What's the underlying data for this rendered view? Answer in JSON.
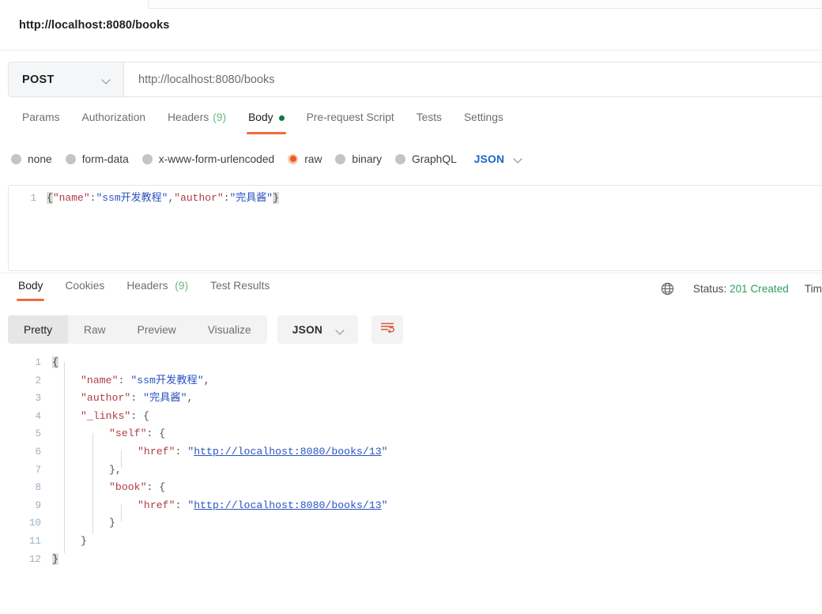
{
  "request": {
    "title": "http://localhost:8080/books",
    "method": "POST",
    "url": "http://localhost:8080/books",
    "tabs": [
      {
        "label": "Params",
        "active": false
      },
      {
        "label": "Authorization",
        "active": false
      },
      {
        "label": "Headers",
        "count": "(9)",
        "active": false
      },
      {
        "label": "Body",
        "active": true,
        "dot": true
      },
      {
        "label": "Pre-request Script",
        "active": false
      },
      {
        "label": "Tests",
        "active": false
      },
      {
        "label": "Settings",
        "active": false
      }
    ],
    "body_types": [
      {
        "label": "none",
        "selected": false
      },
      {
        "label": "form-data",
        "selected": false
      },
      {
        "label": "x-www-form-urlencoded",
        "selected": false
      },
      {
        "label": "raw",
        "selected": true
      },
      {
        "label": "binary",
        "selected": false
      },
      {
        "label": "GraphQL",
        "selected": false
      }
    ],
    "format": "JSON",
    "editor": {
      "line_number": "1",
      "raw": "{\"name\":\"ssm开发教程\",\"author\":\"完具酱\"}",
      "tokens": {
        "open_brace": "{",
        "key_name": "\"name\"",
        "colon1": ":",
        "val_name": "\"ssm开发教程\"",
        "comma": ",",
        "key_author": "\"author\"",
        "colon2": ":",
        "val_author": "\"完具酱\"",
        "close_brace": "}"
      }
    }
  },
  "response": {
    "tabs": [
      {
        "label": "Body",
        "active": true
      },
      {
        "label": "Cookies",
        "active": false
      },
      {
        "label": "Headers",
        "count": "(9)",
        "active": false
      },
      {
        "label": "Test Results",
        "active": false
      }
    ],
    "status_label": "Status:",
    "status_value": "201 Created",
    "time_label": "Tim",
    "globe_icon": "globe-icon",
    "view_modes": [
      {
        "label": "Pretty",
        "active": true
      },
      {
        "label": "Raw",
        "active": false
      },
      {
        "label": "Preview",
        "active": false
      },
      {
        "label": "Visualize",
        "active": false
      }
    ],
    "format": "JSON",
    "wrap_icon": "word-wrap-icon",
    "body_lines": [
      {
        "n": "1",
        "indent": 0,
        "parts": [
          {
            "t": "{",
            "c": "brace-hl"
          }
        ]
      },
      {
        "n": "2",
        "indent": 1,
        "parts": [
          {
            "t": "\"name\"",
            "c": "tok-key"
          },
          {
            "t": ": ",
            "c": "tok-punc"
          },
          {
            "t": "\"ssm开发教程\"",
            "c": "tok-str"
          },
          {
            "t": ",",
            "c": "tok-punc"
          }
        ]
      },
      {
        "n": "3",
        "indent": 1,
        "parts": [
          {
            "t": "\"author\"",
            "c": "tok-key"
          },
          {
            "t": ": ",
            "c": "tok-punc"
          },
          {
            "t": "\"完具酱\"",
            "c": "tok-str"
          },
          {
            "t": ",",
            "c": "tok-punc"
          }
        ]
      },
      {
        "n": "4",
        "indent": 1,
        "parts": [
          {
            "t": "\"_links\"",
            "c": "tok-key"
          },
          {
            "t": ": {",
            "c": "tok-punc"
          }
        ]
      },
      {
        "n": "5",
        "indent": 2,
        "parts": [
          {
            "t": "\"self\"",
            "c": "tok-key"
          },
          {
            "t": ": {",
            "c": "tok-punc"
          }
        ]
      },
      {
        "n": "6",
        "indent": 3,
        "parts": [
          {
            "t": "\"href\"",
            "c": "tok-key"
          },
          {
            "t": ": ",
            "c": "tok-punc"
          },
          {
            "t": "\"",
            "c": "tok-str"
          },
          {
            "t": "http://localhost:8080/books/13",
            "c": "lnk"
          },
          {
            "t": "\"",
            "c": "tok-str"
          }
        ]
      },
      {
        "n": "7",
        "indent": 2,
        "parts": [
          {
            "t": "},",
            "c": "tok-punc"
          }
        ]
      },
      {
        "n": "8",
        "indent": 2,
        "parts": [
          {
            "t": "\"book\"",
            "c": "tok-key"
          },
          {
            "t": ": {",
            "c": "tok-punc"
          }
        ]
      },
      {
        "n": "9",
        "indent": 3,
        "parts": [
          {
            "t": "\"href\"",
            "c": "tok-key"
          },
          {
            "t": ": ",
            "c": "tok-punc"
          },
          {
            "t": "\"",
            "c": "tok-str"
          },
          {
            "t": "http://localhost:8080/books/13",
            "c": "lnk"
          },
          {
            "t": "\"",
            "c": "tok-str"
          }
        ]
      },
      {
        "n": "10",
        "indent": 2,
        "parts": [
          {
            "t": "}",
            "c": "tok-punc"
          }
        ]
      },
      {
        "n": "11",
        "indent": 1,
        "parts": [
          {
            "t": "}",
            "c": "tok-punc"
          }
        ]
      },
      {
        "n": "12",
        "indent": 0,
        "parts": [
          {
            "t": "}",
            "c": "brace-hl"
          }
        ]
      }
    ]
  },
  "colors": {
    "accent": "#ef6c3e",
    "success": "#2f9e5f",
    "link": "#2a53c1",
    "key": "#b03a48",
    "body_dot": "#0b7a3f"
  }
}
